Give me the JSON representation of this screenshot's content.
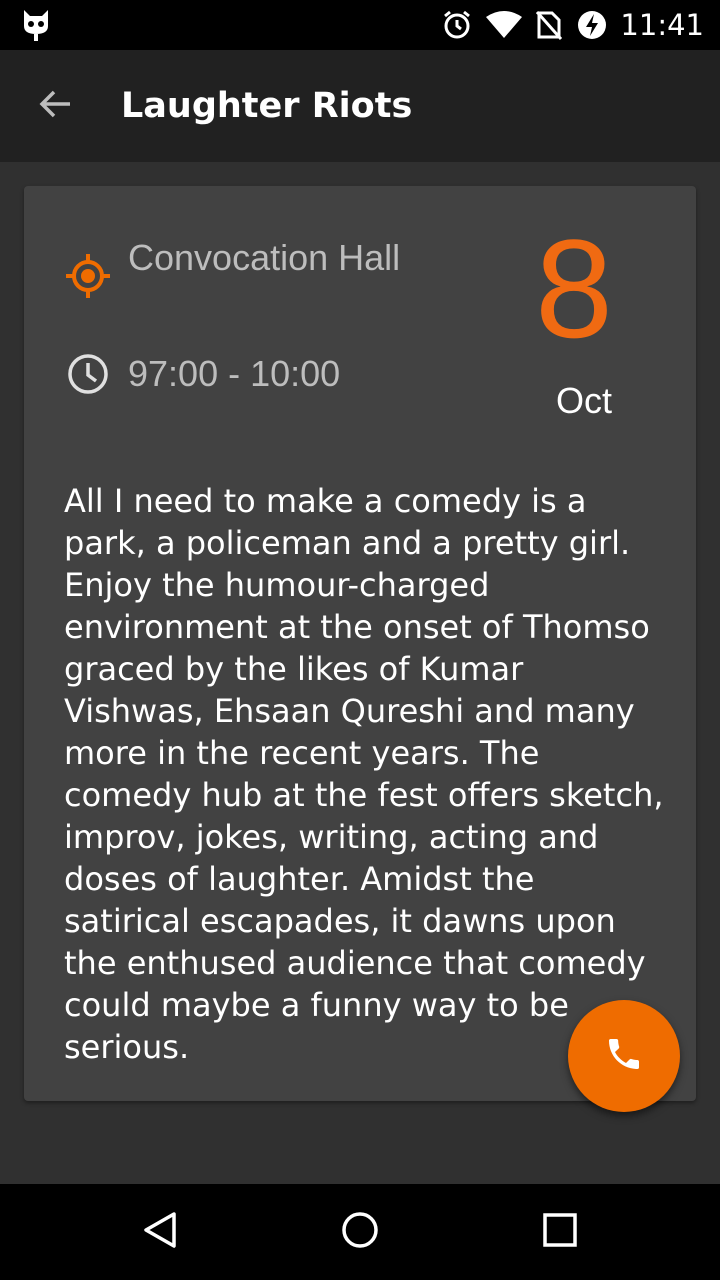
{
  "status_bar": {
    "time": "11:41",
    "icons": [
      "cat-app-icon",
      "alarm-icon",
      "wifi-icon",
      "no-sim-icon",
      "battery-charging-icon"
    ]
  },
  "app_bar": {
    "title": "Laughter Riots",
    "back_icon": "arrow-back-icon"
  },
  "event": {
    "venue": "Convocation Hall",
    "time_range": "97:00 - 10:00",
    "day": "8",
    "month": "Oct",
    "description": "All I need to make a comedy is a park, a policeman and a pretty girl. Enjoy the humour-charged environment at the onset of Thomso graced by the likes of Kumar Vishwas, Ehsaan Qureshi and many more in the recent years. The comedy hub at the fest offers sketch, improv, jokes, writing, acting and doses of laughter. Amidst the satirical escapades, it dawns upon the enthused audience that comedy could maybe a funny way to be serious."
  },
  "fab": {
    "icon": "phone-icon"
  },
  "nav_bar": {
    "icons": [
      "back-triangle-icon",
      "home-circle-icon",
      "recents-square-icon"
    ]
  },
  "colors": {
    "accent": "#ef6c00",
    "date_accent": "#f06a12",
    "background": "#303030",
    "card": "#424242",
    "app_bar": "#212121"
  }
}
